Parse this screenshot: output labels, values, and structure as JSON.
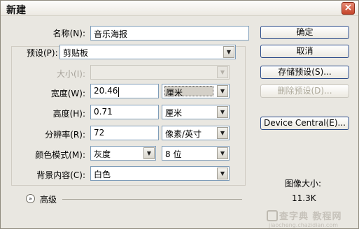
{
  "window": {
    "title": "新建",
    "close_glyph": "×"
  },
  "form": {
    "name_label": "名称(N):",
    "name_value": "音乐海报",
    "preset_label": "预设(P):",
    "preset_value": "剪贴板",
    "size_label": "大小(I):",
    "size_value": "",
    "width_label": "宽度(W):",
    "width_value": "20.46",
    "width_unit": "厘米",
    "height_label": "高度(H):",
    "height_value": "0.71",
    "height_unit": "厘米",
    "resolution_label": "分辨率(R):",
    "resolution_value": "72",
    "resolution_unit": "像素/英寸",
    "color_mode_label": "颜色模式(M):",
    "color_mode_value": "灰度",
    "bit_depth_value": "8 位",
    "background_label": "背景内容(C):",
    "background_value": "白色",
    "advanced_label": "高级"
  },
  "buttons": {
    "ok": "确定",
    "cancel": "取消",
    "save_preset": "存储预设(S)...",
    "delete_preset": "删除预设(D)...",
    "device_central": "Device Central(E)..."
  },
  "info": {
    "image_size_label": "图像大小:",
    "image_size_value": "11.3K"
  },
  "watermark": {
    "main": "查字典 教程网",
    "sub": "jiaocheng.chazidian.com"
  },
  "icons": {
    "dropdown": "▼",
    "advanced_toggle": "»"
  },
  "colors": {
    "dialog_bg": "#e9e7e1",
    "button_border": "#2b4b89",
    "disabled_text": "#aca899"
  }
}
